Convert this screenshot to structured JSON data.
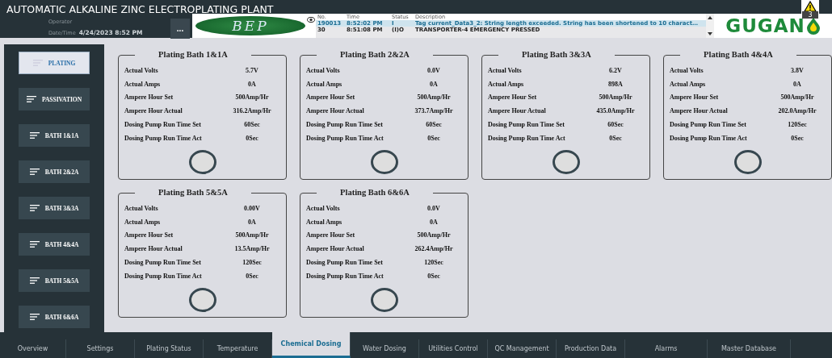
{
  "header": {
    "title": "AUTOMATIC ALKALINE ZINC ELECTROPLATING PLANT",
    "operator_label": "Operator",
    "datetime_label": "Date/Time",
    "datetime": "4/24/2023 8:52 PM",
    "menu_button": "...",
    "logo_text": "BEP",
    "brand": "GUGAN",
    "alarm_count": "3"
  },
  "alarms": {
    "columns": [
      "No.",
      "Time",
      "Status",
      "Description"
    ],
    "rows": [
      {
        "no": "190013",
        "time": "8:52:02 PM",
        "status": "I",
        "description": "Tag current_Data3_2: String length exceeded. String has been shortened to 10 charact…",
        "selected": true
      },
      {
        "no": "30",
        "time": "8:51:08 PM",
        "status": "(I)O",
        "description": "TRANSPORTER-4 EMERGENCY PRESSED",
        "selected": false
      }
    ]
  },
  "sidebar": {
    "items": [
      {
        "label": "PLATING",
        "selected": true
      },
      {
        "label": "PASSIVATION",
        "selected": false
      },
      {
        "label": "BATH 1&1A",
        "selected": false
      },
      {
        "label": "BATH 2&2A",
        "selected": false
      },
      {
        "label": "BATH 3&3A",
        "selected": false
      },
      {
        "label": "BATH 4&4A",
        "selected": false
      },
      {
        "label": "BATH 5&5A",
        "selected": false
      },
      {
        "label": "BATH 6&6A",
        "selected": false
      }
    ]
  },
  "baths": [
    {
      "title": "Plating Bath 1&1A",
      "fields": [
        {
          "label": "Actual Volts",
          "value": "5.7V"
        },
        {
          "label": "Actual Amps",
          "value": "0A"
        },
        {
          "label": "Ampere Hour Set",
          "value": "500Amp/Hr"
        },
        {
          "label": "Ampere Hour Actual",
          "value": "316.2Amp/Hr"
        },
        {
          "label": "Dosing Pump Run Time Set",
          "value": "60Sec"
        },
        {
          "label": "Dosing Pump Run Time Act",
          "value": "0Sec"
        }
      ]
    },
    {
      "title": "Plating Bath 2&2A",
      "fields": [
        {
          "label": "Actual Volts",
          "value": "0.0V"
        },
        {
          "label": "Actual Amps",
          "value": "0A"
        },
        {
          "label": "Ampere Hour Set",
          "value": "500Amp/Hr"
        },
        {
          "label": "Ampere Hour Actual",
          "value": "373.7Amp/Hr"
        },
        {
          "label": "Dosing Pump Run Time Set",
          "value": "60Sec"
        },
        {
          "label": "Dosing Pump Run Time Act",
          "value": "0Sec"
        }
      ]
    },
    {
      "title": "Plating Bath 3&3A",
      "fields": [
        {
          "label": "Actual Volts",
          "value": "6.2V"
        },
        {
          "label": "Actual Amps",
          "value": "898A"
        },
        {
          "label": "Ampere Hour Set",
          "value": "500Amp/Hr"
        },
        {
          "label": "Ampere Hour Actual",
          "value": "435.0Amp/Hr"
        },
        {
          "label": "Dosing Pump Run Time Set",
          "value": "60Sec"
        },
        {
          "label": "Dosing Pump Run Time Act",
          "value": "0Sec"
        }
      ]
    },
    {
      "title": "Plating Bath 4&4A",
      "fields": [
        {
          "label": "Actual Volts",
          "value": "3.8V"
        },
        {
          "label": "Actual Amps",
          "value": "0A"
        },
        {
          "label": "Ampere Hour Set",
          "value": "500Amp/Hr"
        },
        {
          "label": "Ampere Hour Actual",
          "value": "202.0Amp/Hr"
        },
        {
          "label": "Dosing Pump Run Time Set",
          "value": "120Sec"
        },
        {
          "label": "Dosing Pump Run Time Act",
          "value": "0Sec"
        }
      ]
    },
    {
      "title": "Plating Bath 5&5A",
      "fields": [
        {
          "label": "Actual Volts",
          "value": "0.00V"
        },
        {
          "label": "Actual Amps",
          "value": "0A"
        },
        {
          "label": "Ampere Hour Set",
          "value": "500Amp/Hr"
        },
        {
          "label": "Ampere Hour Actual",
          "value": "13.5Amp/Hr"
        },
        {
          "label": "Dosing Pump Run Time Set",
          "value": "120Sec"
        },
        {
          "label": "Dosing Pump Run Time Act",
          "value": "0Sec"
        }
      ]
    },
    {
      "title": "Plating Bath 6&6A",
      "fields": [
        {
          "label": "Actual Volts",
          "value": "0.0V"
        },
        {
          "label": "Actual Amps",
          "value": "0A"
        },
        {
          "label": "Ampere Hour Set",
          "value": "500Amp/Hr"
        },
        {
          "label": "Ampere Hour Actual",
          "value": "262.4Amp/Hr"
        },
        {
          "label": "Dosing Pump Run Time Set",
          "value": "120Sec"
        },
        {
          "label": "Dosing Pump Run Time Act",
          "value": "0Sec"
        }
      ]
    }
  ],
  "tabs": [
    {
      "label": "Overview",
      "selected": false
    },
    {
      "label": "Settings",
      "selected": false
    },
    {
      "label": "Plating Status",
      "selected": false
    },
    {
      "label": "Temperature",
      "selected": false
    },
    {
      "label": "Chemical Dosing",
      "selected": true
    },
    {
      "label": "Water Dosing",
      "selected": false
    },
    {
      "label": "Utilities Control",
      "selected": false
    },
    {
      "label": "QC Management",
      "selected": false
    },
    {
      "label": "Production Data",
      "selected": false
    },
    {
      "label": "Alarms",
      "selected": false
    },
    {
      "label": "Master Database",
      "selected": false
    }
  ]
}
